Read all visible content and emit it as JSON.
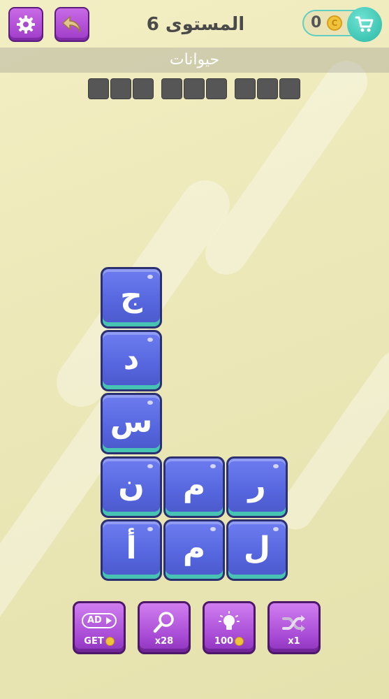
{
  "header": {
    "level_title": "المستوى 6",
    "coins": "0",
    "coin_symbol": "C"
  },
  "category": "حيوانات",
  "answer_slots": {
    "words": [
      3,
      3,
      3
    ]
  },
  "tiles": [
    {
      "letter": "ج"
    },
    {
      "letter": "د"
    },
    {
      "letter": "س"
    },
    {
      "letter": "ن"
    },
    {
      "letter": "م"
    },
    {
      "letter": "ر"
    },
    {
      "letter": "أ"
    },
    {
      "letter": "م"
    },
    {
      "letter": "ل"
    }
  ],
  "tools": {
    "ad": {
      "badge": "AD",
      "label": "GET"
    },
    "reveal": {
      "label": "x28"
    },
    "hint": {
      "label": "100"
    },
    "shuffle": {
      "label": "x1"
    }
  },
  "colors": {
    "tile": "#5565dd",
    "tool": "#a649d4",
    "cart": "#29b8a6",
    "coin": "#f0c43a"
  },
  "icons": [
    "gear-icon",
    "back-arrow-icon",
    "cart-icon",
    "magnifier-icon",
    "lightbulb-icon",
    "shuffle-icon",
    "video-ad-icon"
  ]
}
